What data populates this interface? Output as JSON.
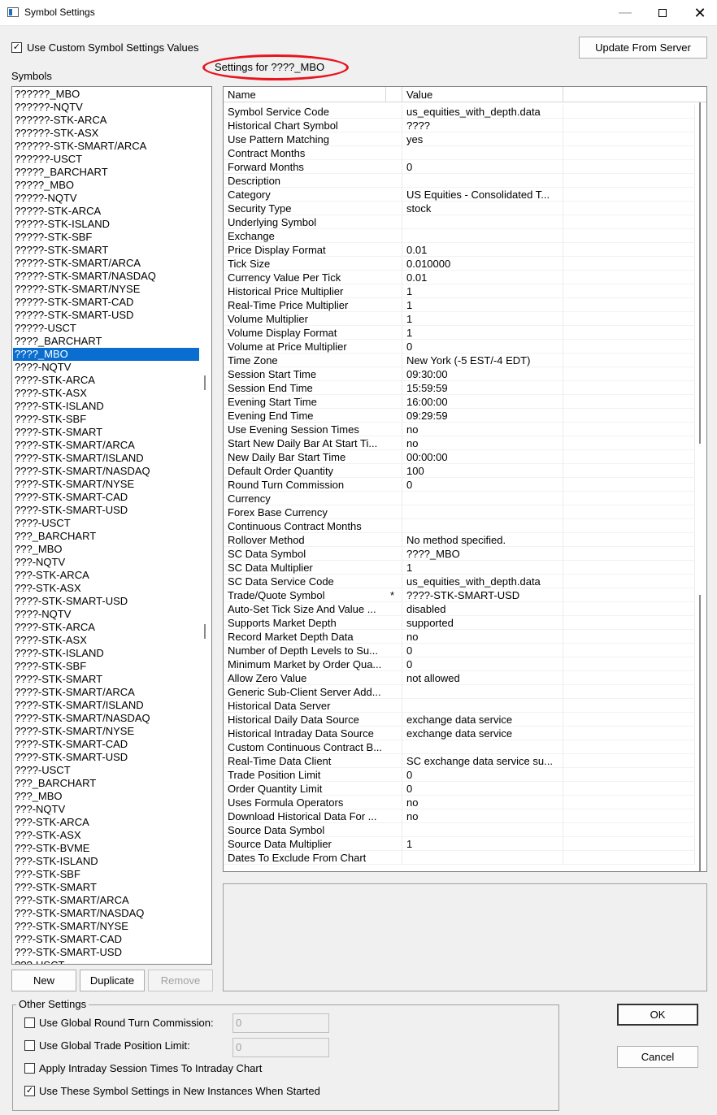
{
  "window": {
    "title": "Symbol Settings",
    "minimize": "—",
    "close": "✕"
  },
  "top": {
    "use_custom_label": "Use Custom Symbol Settings Values",
    "use_custom_checked": "✓",
    "update_button": "Update From Server",
    "symbols_label": "Symbols",
    "settings_for": "Settings for ????_MBO"
  },
  "symbols": [
    "??????_MBO",
    "??????-NQTV",
    "??????-STK-ARCA",
    "??????-STK-ASX",
    "??????-STK-SMART/ARCA",
    "??????-USCT",
    "?????_BARCHART",
    "?????_MBO",
    "?????-NQTV",
    "?????-STK-ARCA",
    "?????-STK-ISLAND",
    "?????-STK-SBF",
    "?????-STK-SMART",
    "?????-STK-SMART/ARCA",
    "?????-STK-SMART/NASDAQ",
    "?????-STK-SMART/NYSE",
    "?????-STK-SMART-CAD",
    "?????-STK-SMART-USD",
    "?????-USCT",
    "????_BARCHART",
    "????_MBO",
    "????-NQTV",
    "????-STK-ARCA",
    "????-STK-ASX",
    "????-STK-ISLAND",
    "????-STK-SBF",
    "????-STK-SMART",
    "????-STK-SMART/ARCA",
    "????-STK-SMART/ISLAND",
    "????-STK-SMART/NASDAQ",
    "????-STK-SMART/NYSE",
    "????-STK-SMART-CAD",
    "????-STK-SMART-USD",
    "????-USCT",
    "???_BARCHART",
    "???_MBO",
    "???-NQTV",
    "???-STK-ARCA",
    "???-STK-ASX",
    "????-STK-SMART-USD",
    "????-NQTV",
    "????-STK-ARCA",
    "????-STK-ASX",
    "????-STK-ISLAND",
    "????-STK-SBF",
    "????-STK-SMART",
    "????-STK-SMART/ARCA",
    "????-STK-SMART/ISLAND",
    "????-STK-SMART/NASDAQ",
    "????-STK-SMART/NYSE",
    "????-STK-SMART-CAD",
    "????-STK-SMART-USD",
    "????-USCT",
    "???_BARCHART",
    "???_MBO",
    "???-NQTV",
    "???-STK-ARCA",
    "???-STK-ASX",
    "???-STK-BVME",
    "???-STK-ISLAND",
    "???-STK-SBF",
    "???-STK-SMART",
    "???-STK-SMART/ARCA",
    "???-STK-SMART/NASDAQ",
    "???-STK-SMART/NYSE",
    "???-STK-SMART-CAD",
    "???-STK-SMART-USD",
    "???-USCT"
  ],
  "selected_symbol_index": 20,
  "grid": {
    "headers": {
      "name": "Name",
      "value": "Value"
    },
    "rows": [
      {
        "name": "Symbol Service Code",
        "flag": "",
        "value": "us_equities_with_depth.data"
      },
      {
        "name": "Historical Chart Symbol",
        "flag": "",
        "value": "????"
      },
      {
        "name": "Use Pattern Matching",
        "flag": "",
        "value": "yes"
      },
      {
        "name": "Contract Months",
        "flag": "",
        "value": ""
      },
      {
        "name": "Forward Months",
        "flag": "",
        "value": "0"
      },
      {
        "name": "Description",
        "flag": "",
        "value": ""
      },
      {
        "name": "Category",
        "flag": "",
        "value": "US Equities - Consolidated T..."
      },
      {
        "name": "Security Type",
        "flag": "",
        "value": "stock"
      },
      {
        "name": "Underlying Symbol",
        "flag": "",
        "value": ""
      },
      {
        "name": "Exchange",
        "flag": "",
        "value": ""
      },
      {
        "name": "Price Display Format",
        "flag": "",
        "value": "0.01"
      },
      {
        "name": "Tick Size",
        "flag": "",
        "value": "0.010000"
      },
      {
        "name": "Currency Value Per Tick",
        "flag": "",
        "value": "0.01"
      },
      {
        "name": "Historical Price Multiplier",
        "flag": "",
        "value": "1"
      },
      {
        "name": "Real-Time Price Multiplier",
        "flag": "",
        "value": "1"
      },
      {
        "name": "Volume Multiplier",
        "flag": "",
        "value": "1"
      },
      {
        "name": "Volume Display Format",
        "flag": "",
        "value": "1"
      },
      {
        "name": "Volume at Price Multiplier",
        "flag": "",
        "value": "0"
      },
      {
        "name": "Time Zone",
        "flag": "",
        "value": "New York (-5 EST/-4 EDT)"
      },
      {
        "name": "Session Start Time",
        "flag": "",
        "value": "09:30:00"
      },
      {
        "name": "Session End Time",
        "flag": "",
        "value": "15:59:59"
      },
      {
        "name": "Evening Start Time",
        "flag": "",
        "value": "16:00:00"
      },
      {
        "name": "Evening End Time",
        "flag": "",
        "value": "09:29:59"
      },
      {
        "name": "Use Evening Session Times",
        "flag": "",
        "value": "no"
      },
      {
        "name": "Start New Daily Bar At Start Ti...",
        "flag": "",
        "value": "no"
      },
      {
        "name": "New Daily Bar Start Time",
        "flag": "",
        "value": "00:00:00"
      },
      {
        "name": "Default Order Quantity",
        "flag": "",
        "value": "100"
      },
      {
        "name": "Round Turn Commission",
        "flag": "",
        "value": "0"
      },
      {
        "name": "Currency",
        "flag": "",
        "value": ""
      },
      {
        "name": "Forex Base Currency",
        "flag": "",
        "value": ""
      },
      {
        "name": "Continuous Contract Months",
        "flag": "",
        "value": ""
      },
      {
        "name": "Rollover Method",
        "flag": "",
        "value": "No method specified."
      },
      {
        "name": "SC Data Symbol",
        "flag": "",
        "value": "????_MBO"
      },
      {
        "name": "SC Data Multiplier",
        "flag": "",
        "value": "1"
      },
      {
        "name": "SC Data Service Code",
        "flag": "",
        "value": "us_equities_with_depth.data"
      },
      {
        "name": "Trade/Quote Symbol",
        "flag": "*",
        "value": "????-STK-SMART-USD"
      },
      {
        "name": "Auto-Set Tick Size And Value ...",
        "flag": "",
        "value": "disabled"
      },
      {
        "name": "Supports Market Depth",
        "flag": "",
        "value": "supported"
      },
      {
        "name": "Record Market Depth Data",
        "flag": "",
        "value": "no"
      },
      {
        "name": "Number of Depth Levels to Su...",
        "flag": "",
        "value": "0"
      },
      {
        "name": "Minimum Market by Order Qua...",
        "flag": "",
        "value": "0"
      },
      {
        "name": "Allow Zero Value",
        "flag": "",
        "value": "not allowed"
      },
      {
        "name": "Generic Sub-Client Server Add...",
        "flag": "",
        "value": ""
      },
      {
        "name": "Historical Data Server",
        "flag": "",
        "value": ""
      },
      {
        "name": "Historical Daily Data Source",
        "flag": "",
        "value": "exchange data service"
      },
      {
        "name": "Historical Intraday Data Source",
        "flag": "",
        "value": "exchange data service"
      },
      {
        "name": "Custom Continuous Contract B...",
        "flag": "",
        "value": ""
      },
      {
        "name": "Real-Time Data Client",
        "flag": "",
        "value": "SC exchange data service su..."
      },
      {
        "name": "Trade Position Limit",
        "flag": "",
        "value": "0"
      },
      {
        "name": "Order Quantity Limit",
        "flag": "",
        "value": "0"
      },
      {
        "name": "Uses Formula Operators",
        "flag": "",
        "value": "no"
      },
      {
        "name": "Download Historical Data For ...",
        "flag": "",
        "value": "no"
      },
      {
        "name": "Source Data Symbol",
        "flag": "",
        "value": ""
      },
      {
        "name": "Source Data Multiplier",
        "flag": "",
        "value": "1"
      },
      {
        "name": "Dates To Exclude From Chart",
        "flag": "",
        "value": ""
      }
    ]
  },
  "buttons": {
    "new": "New",
    "duplicate": "Duplicate",
    "remove": "Remove",
    "ok": "OK",
    "cancel": "Cancel"
  },
  "other_settings": {
    "title": "Other Settings",
    "global_commission_label": "Use Global Round Turn Commission:",
    "global_commission_value": "0",
    "global_position_label": "Use Global Trade Position Limit:",
    "global_position_value": "0",
    "apply_intraday_label": "Apply Intraday Session Times To Intraday Chart",
    "use_in_new_label": "Use These Symbol Settings in New Instances When Started",
    "use_in_new_checked": "✓"
  }
}
